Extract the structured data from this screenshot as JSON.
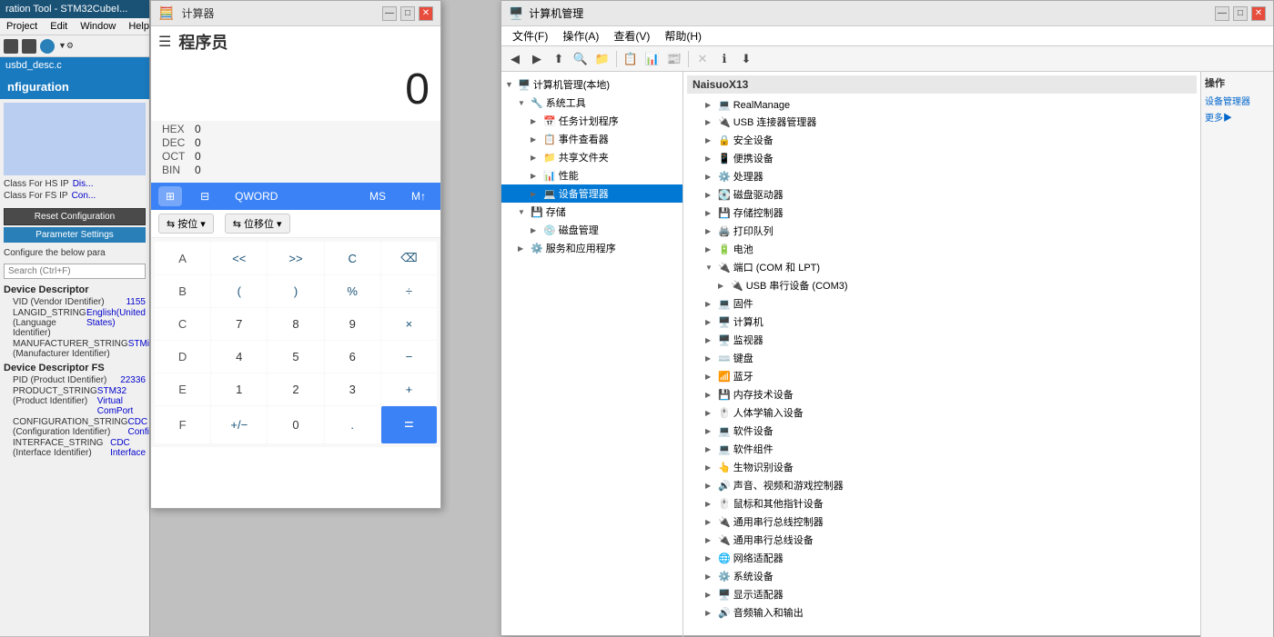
{
  "stm32": {
    "titlebar": "ration Tool - STM32CubeI...",
    "menu": {
      "project": "Project",
      "edit": "Edit",
      "window": "Window",
      "help": "Help"
    },
    "tab": "usbd_desc.c",
    "config_header": "nfiguration",
    "sections": {
      "class_hs_ip": "Class For HS IP",
      "class_hs_value": "Dis...",
      "class_fs_ip": "Class For FS IP",
      "class_fs_value": "Con..."
    },
    "reset_btn": "Reset Configuration",
    "param_btn": "Parameter Settings",
    "configure_text": "Configure the below para",
    "search_placeholder": "Search (Ctrl+F)",
    "device_descriptor": "Device Descriptor",
    "descriptors": [
      {
        "label": "VID (Vendor IDentifier)",
        "value": "1155"
      },
      {
        "label": "LANGID_STRING (Language Identifier)",
        "value": "English(United States)"
      },
      {
        "label": "MANUFACTURER_STRING (Manufacturer Identifier)",
        "value": "STMicroelectronics"
      }
    ],
    "device_descriptor_fs": "Device Descriptor FS",
    "descriptors_fs": [
      {
        "label": "PID (Product IDentifier)",
        "value": "22336"
      },
      {
        "label": "PRODUCT_STRING (Product Identifier)",
        "value": "STM32 Virtual ComPort"
      },
      {
        "label": "CONFIGURATION_STRING (Configuration Identifier)",
        "value": "CDC Config"
      },
      {
        "label": "INTERFACE_STRING (Interface Identifier)",
        "value": "CDC Interface"
      }
    ]
  },
  "calculator": {
    "titlebar": "计算器",
    "menu_title": "程序员",
    "display_value": "0",
    "hex": {
      "label": "HEX",
      "value": "0"
    },
    "dec": {
      "label": "DEC",
      "value": "0"
    },
    "oct": {
      "label": "OCT",
      "value": "0"
    },
    "bin": {
      "label": "BIN",
      "value": "0"
    },
    "modes": {
      "dot_grid": "⠿",
      "four_squares": "⊞",
      "qword": "QWORD",
      "ms": "MS",
      "m_plus": "M↑"
    },
    "shift": {
      "bit_shift_label": "按位",
      "bit_shift_icon": "⇆",
      "shift_label": "位移位",
      "shift_icon": "⇆"
    },
    "buttons": [
      {
        "label": "A",
        "type": "hex-letter"
      },
      {
        "label": "<<",
        "type": "op"
      },
      {
        "label": ">>",
        "type": "op"
      },
      {
        "label": "C",
        "type": "op"
      },
      {
        "label": "⌫",
        "type": "op"
      },
      {
        "label": "B",
        "type": "hex-letter"
      },
      {
        "label": "(",
        "type": "op"
      },
      {
        "label": ")",
        "type": "op"
      },
      {
        "label": "%",
        "type": "op"
      },
      {
        "label": "÷",
        "type": "op"
      },
      {
        "label": "C",
        "type": "hex-letter"
      },
      {
        "label": "7",
        "type": "num"
      },
      {
        "label": "8",
        "type": "num"
      },
      {
        "label": "9",
        "type": "num"
      },
      {
        "label": "×",
        "type": "op"
      },
      {
        "label": "D",
        "type": "hex-letter"
      },
      {
        "label": "4",
        "type": "num"
      },
      {
        "label": "5",
        "type": "num"
      },
      {
        "label": "6",
        "type": "num"
      },
      {
        "label": "−",
        "type": "op"
      },
      {
        "label": "E",
        "type": "hex-letter"
      },
      {
        "label": "1",
        "type": "num"
      },
      {
        "label": "2",
        "type": "num"
      },
      {
        "label": "3",
        "type": "num"
      },
      {
        "label": "+",
        "type": "op"
      },
      {
        "label": "F",
        "type": "hex-letter"
      },
      {
        "label": "+/−",
        "type": "op"
      },
      {
        "label": "0",
        "type": "num"
      },
      {
        "label": ".",
        "type": "op"
      },
      {
        "label": "=",
        "type": "equals"
      }
    ]
  },
  "devmgr": {
    "titlebar": "计算机管理",
    "menu": {
      "file": "文件(F)",
      "action": "操作(A)",
      "view": "查看(V)",
      "help": "帮助(H)"
    },
    "left_tree": {
      "root": "计算机管理(本地)",
      "items": [
        {
          "label": "系统工具",
          "indent": 1,
          "expanded": true,
          "icon": "🔧"
        },
        {
          "label": "任务计划程序",
          "indent": 2,
          "icon": "📅"
        },
        {
          "label": "事件查看器",
          "indent": 2,
          "icon": "📋"
        },
        {
          "label": "共享文件夹",
          "indent": 2,
          "icon": "📁"
        },
        {
          "label": "性能",
          "indent": 2,
          "icon": "📊"
        },
        {
          "label": "设备管理器",
          "indent": 2,
          "icon": "💻",
          "selected": true
        },
        {
          "label": "存储",
          "indent": 1,
          "expanded": true,
          "icon": "💾"
        },
        {
          "label": "磁盘管理",
          "indent": 2,
          "icon": "💿"
        },
        {
          "label": "服务和应用程序",
          "indent": 1,
          "icon": "⚙️"
        }
      ]
    },
    "right_tree": {
      "root": "NaisuoX13",
      "items": [
        {
          "label": "RealManage",
          "indent": 1,
          "icon": "💻"
        },
        {
          "label": "USB 连接器管理器",
          "indent": 1,
          "icon": "🔌"
        },
        {
          "label": "安全设备",
          "indent": 1,
          "icon": "🔒"
        },
        {
          "label": "便携设备",
          "indent": 1,
          "icon": "📱"
        },
        {
          "label": "处理器",
          "indent": 1,
          "icon": "⚙️"
        },
        {
          "label": "磁盘驱动器",
          "indent": 1,
          "icon": "💽"
        },
        {
          "label": "存储控制器",
          "indent": 1,
          "icon": "💾"
        },
        {
          "label": "打印队列",
          "indent": 1,
          "icon": "🖨️"
        },
        {
          "label": "电池",
          "indent": 1,
          "icon": "🔋"
        },
        {
          "label": "端口 (COM 和 LPT)",
          "indent": 1,
          "expanded": true,
          "icon": "🔌"
        },
        {
          "label": "USB 串行设备 (COM3)",
          "indent": 2,
          "icon": "🔌"
        },
        {
          "label": "固件",
          "indent": 1,
          "icon": "💻"
        },
        {
          "label": "计算机",
          "indent": 1,
          "icon": "🖥️"
        },
        {
          "label": "监视器",
          "indent": 1,
          "icon": "🖥️"
        },
        {
          "label": "键盘",
          "indent": 1,
          "icon": "⌨️"
        },
        {
          "label": "蓝牙",
          "indent": 1,
          "icon": "📶"
        },
        {
          "label": "内存技术设备",
          "indent": 1,
          "icon": "💾"
        },
        {
          "label": "人体学输入设备",
          "indent": 1,
          "icon": "🖱️"
        },
        {
          "label": "软件设备",
          "indent": 1,
          "icon": "💻"
        },
        {
          "label": "软件组件",
          "indent": 1,
          "icon": "💻"
        },
        {
          "label": "生物识别设备",
          "indent": 1,
          "icon": "👆"
        },
        {
          "label": "声音、视频和游戏控制器",
          "indent": 1,
          "icon": "🔊"
        },
        {
          "label": "鼠标和其他指针设备",
          "indent": 1,
          "icon": "🖱️"
        },
        {
          "label": "通用串行总线控制器",
          "indent": 1,
          "icon": "🔌"
        },
        {
          "label": "通用串行总线设备",
          "indent": 1,
          "icon": "🔌"
        },
        {
          "label": "网络适配器",
          "indent": 1,
          "icon": "🌐"
        },
        {
          "label": "系统设备",
          "indent": 1,
          "icon": "⚙️"
        },
        {
          "label": "显示适配器",
          "indent": 1,
          "icon": "🖥️"
        },
        {
          "label": "音频输入和输出",
          "indent": 1,
          "icon": "🔊"
        }
      ]
    },
    "sidebar_title": "操作",
    "sidebar_actions": [
      "设备管理器",
      "更多▶"
    ]
  }
}
